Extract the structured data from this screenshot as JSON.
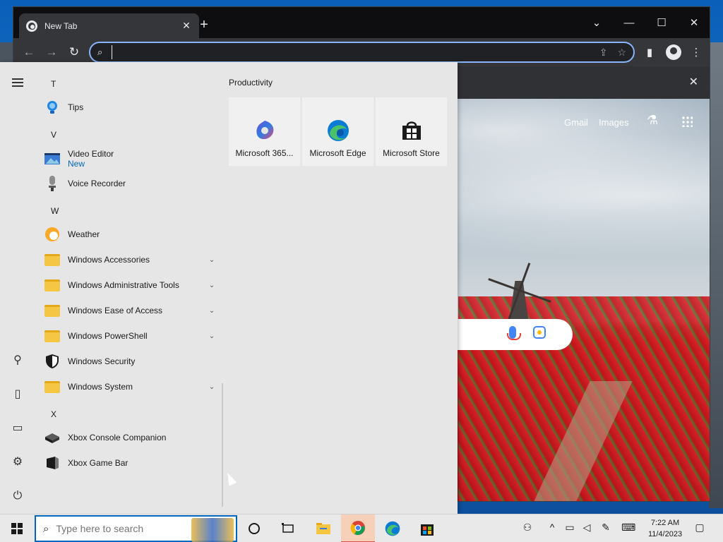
{
  "browser": {
    "tab_title": "New Tab",
    "omnibox_value": "",
    "win_controls": {
      "dropdown": "⌄",
      "minimize": "—",
      "maximize": "☐",
      "close": "✕"
    },
    "banner_close": "✕"
  },
  "newtab": {
    "gmail": "Gmail",
    "images": "Images"
  },
  "start_menu": {
    "letters": {
      "t": "T",
      "v": "V",
      "w": "W",
      "x": "X"
    },
    "apps": {
      "tips": "Tips",
      "video_editor": "Video Editor",
      "video_editor_badge": "New",
      "voice_recorder": "Voice Recorder",
      "weather": "Weather",
      "windows_accessories": "Windows Accessories",
      "windows_admin_tools": "Windows Administrative Tools",
      "windows_ease": "Windows Ease of Access",
      "windows_powershell": "Windows PowerShell",
      "windows_security": "Windows Security",
      "windows_system": "Windows System",
      "xbox_console": "Xbox Console Companion",
      "xbox_game_bar": "Xbox Game Bar"
    },
    "group_title": "Productivity",
    "tiles": {
      "m365": "Microsoft 365...",
      "edge": "Microsoft Edge",
      "store": "Microsoft Store"
    }
  },
  "taskbar": {
    "search_placeholder": "Type here to search",
    "time": "7:22 AM",
    "date": "11/4/2023"
  },
  "colors": {
    "accent": "#0067c0",
    "chrome_focus": "#8ab4f8"
  }
}
